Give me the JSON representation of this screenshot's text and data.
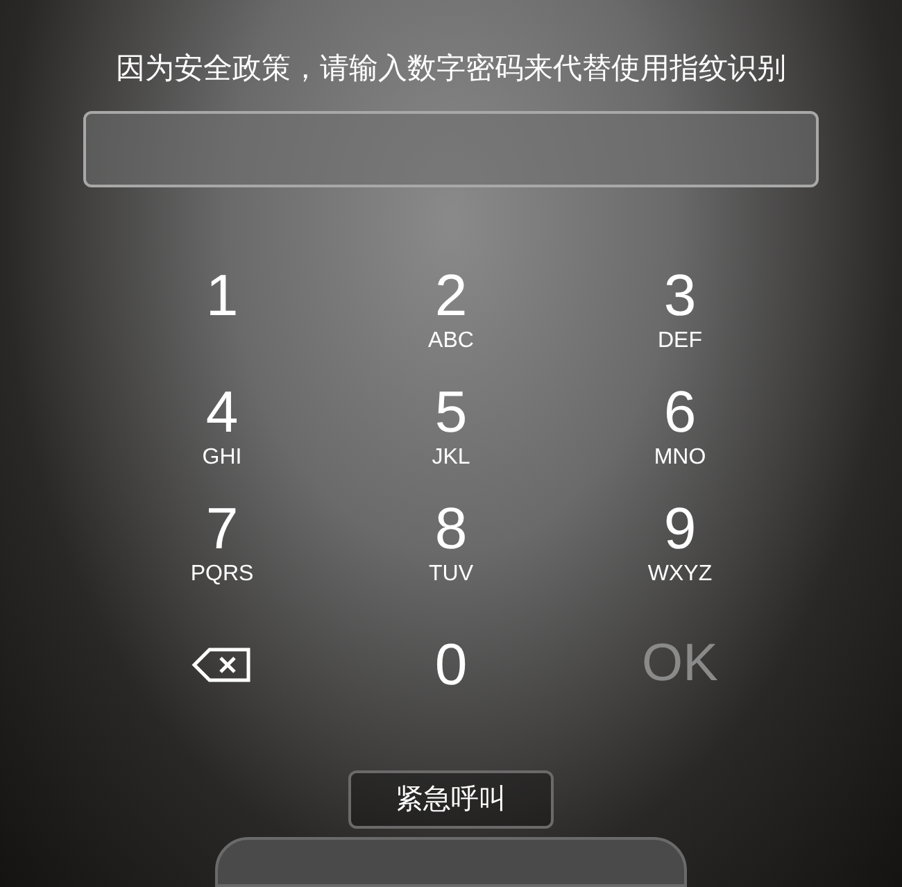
{
  "prompt": "因为安全政策，请输入数字密码来代替使用指纹识别",
  "keys": [
    {
      "kind": "digit",
      "digit": "1"
    },
    {
      "kind": "digit",
      "digit": "2",
      "letters": "ABC"
    },
    {
      "kind": "digit",
      "digit": "3",
      "letters": "DEF"
    },
    {
      "kind": "digit",
      "digit": "4",
      "letters": "GHI"
    },
    {
      "kind": "digit",
      "digit": "5",
      "letters": "JKL"
    },
    {
      "kind": "digit",
      "digit": "6",
      "letters": "MNO"
    },
    {
      "kind": "digit",
      "digit": "7",
      "letters": "PQRS"
    },
    {
      "kind": "digit",
      "digit": "8",
      "letters": "TUV"
    },
    {
      "kind": "digit",
      "digit": "9",
      "letters": "WXYZ"
    },
    {
      "kind": "backspace"
    },
    {
      "kind": "digit",
      "digit": "0"
    },
    {
      "kind": "ok",
      "label": "OK",
      "disabled": true
    }
  ],
  "emergency_button": "紧急呼叫"
}
